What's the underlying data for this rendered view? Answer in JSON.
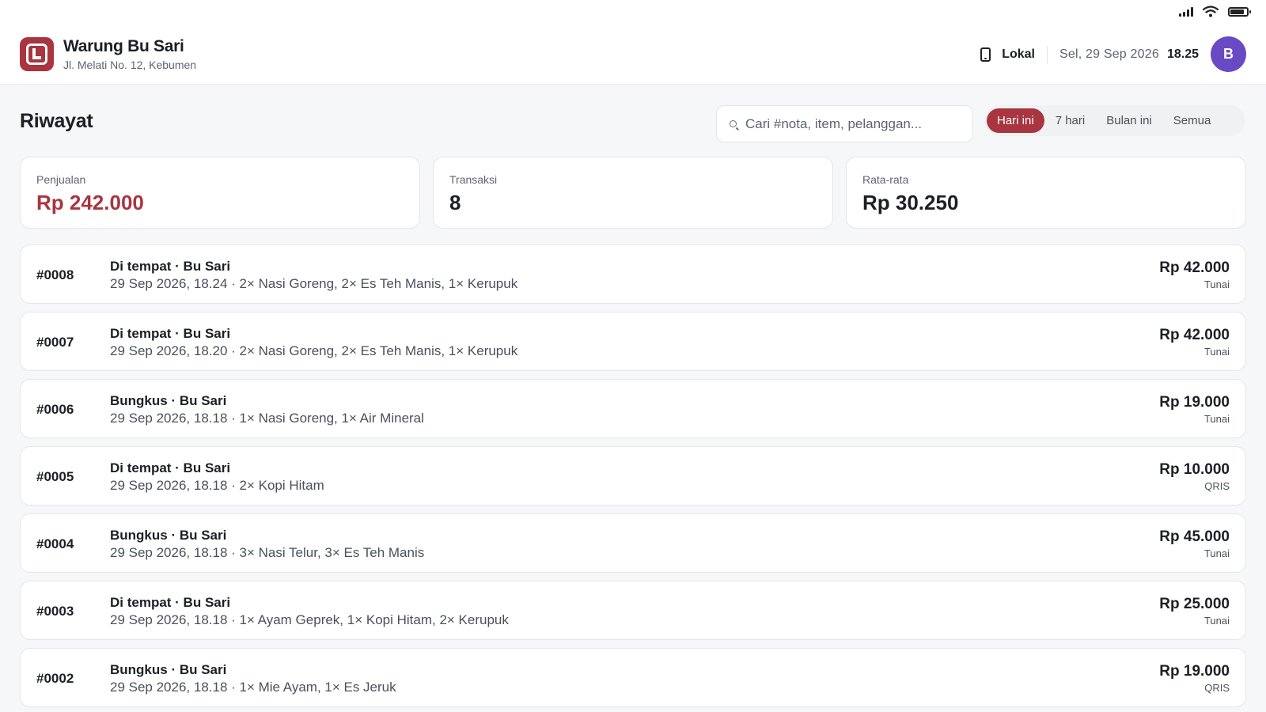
{
  "store": {
    "name": "Warung Bu Sari",
    "address": "Jl. Melati No. 12, Kebumen",
    "mode": "Lokal",
    "date": "Sel, 29 Sep 2026",
    "time": "18.25",
    "avatar_initial": "B"
  },
  "page": {
    "title": "Riwayat",
    "search_placeholder": "Cari #nota, item, pelanggan...",
    "tabs": [
      {
        "label": "Hari ini",
        "active": true
      },
      {
        "label": "7 hari",
        "active": false
      },
      {
        "label": "Bulan ini",
        "active": false
      },
      {
        "label": "Semua",
        "active": false
      }
    ]
  },
  "stats": [
    {
      "label": "Penjualan",
      "value": "Rp 242.000"
    },
    {
      "label": "Transaksi",
      "value": "8"
    },
    {
      "label": "Rata-rata",
      "value": "Rp 30.250"
    }
  ],
  "transactions": [
    {
      "number": "#0008",
      "title": "Di tempat · Bu Sari",
      "detail": "29 Sep 2026, 18.24 · 2× Nasi Goreng, 2× Es Teh Manis, 1× Kerupuk",
      "amount": "Rp 42.000",
      "method": "Tunai"
    },
    {
      "number": "#0007",
      "title": "Di tempat · Bu Sari",
      "detail": "29 Sep 2026, 18.20 · 2× Nasi Goreng, 2× Es Teh Manis, 1× Kerupuk",
      "amount": "Rp 42.000",
      "method": "Tunai"
    },
    {
      "number": "#0006",
      "title": "Bungkus · Bu Sari",
      "detail": "29 Sep 2026, 18.18 · 1× Nasi Goreng, 1× Air Mineral",
      "amount": "Rp 19.000",
      "method": "Tunai"
    },
    {
      "number": "#0005",
      "title": "Di tempat · Bu Sari",
      "detail": "29 Sep 2026, 18.18 · 2× Kopi Hitam",
      "amount": "Rp 10.000",
      "method": "QRIS"
    },
    {
      "number": "#0004",
      "title": "Bungkus · Bu Sari",
      "detail": "29 Sep 2026, 18.18 · 3× Nasi Telur, 3× Es Teh Manis",
      "amount": "Rp 45.000",
      "method": "Tunai"
    },
    {
      "number": "#0003",
      "title": "Di tempat · Bu Sari",
      "detail": "29 Sep 2026, 18.18 · 1× Ayam Geprek, 1× Kopi Hitam, 2× Kerupuk",
      "amount": "Rp 25.000",
      "method": "Tunai"
    },
    {
      "number": "#0002",
      "title": "Bungkus · Bu Sari",
      "detail": "29 Sep 2026, 18.18 · 1× Mie Ayam, 1× Es Jeruk",
      "amount": "Rp 19.000",
      "method": "QRIS"
    }
  ],
  "icons": {
    "signal": "signal-icon",
    "wifi": "wifi-icon",
    "battery": "battery-icon",
    "logo": "store-logo-icon",
    "device": "tablet-icon",
    "search": "search-icon"
  },
  "colors": {
    "accent": "#a8353f",
    "avatar": "#6a49c5",
    "background": "#f6f7f9"
  }
}
